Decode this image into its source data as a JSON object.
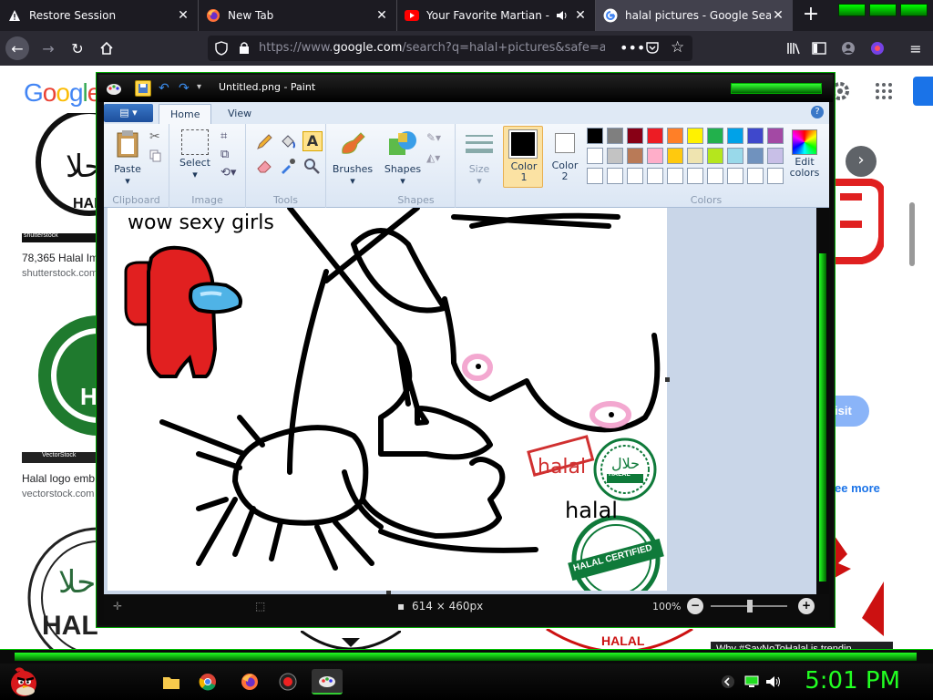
{
  "browser": {
    "tabs": [
      {
        "label": "Restore Session",
        "icon": "warning-icon"
      },
      {
        "label": "New Tab",
        "icon": "firefox-icon"
      },
      {
        "label": "Your Favorite Martian - Sh",
        "icon": "youtube-icon"
      },
      {
        "label": "halal pictures - Google Search",
        "icon": "google-icon"
      }
    ],
    "url_prefix": "https://www.",
    "url_domain": "google.com",
    "url_rest": "/search?q=halal+pictures&safe=a"
  },
  "google": {
    "logo": "Google",
    "results": [
      {
        "caption": "78,365 Halal Im",
        "source": "shutterstock.com",
        "stock": "shutterstock"
      },
      {
        "caption": "Halal logo emb",
        "source": "vectorstock.com",
        "stock": "VectorStock"
      }
    ],
    "visit_label": "isit",
    "see_more": "ee more",
    "trending": "Why #SayNoToHalal is trendin"
  },
  "paint": {
    "title": "Untitled.png - Paint",
    "tabs": [
      "Home",
      "View"
    ],
    "groups": {
      "clipboard": "Clipboard",
      "image": "Image",
      "tools": "Tools",
      "shapes": "Shapes",
      "colors": "Colors"
    },
    "buttons": {
      "paste": "Paste",
      "select": "Select",
      "brushes": "Brushes",
      "shapes": "Shapes",
      "size": "Size",
      "color1": "Color\n1",
      "color2": "Color\n2",
      "edit_colors": "Edit\ncolors"
    },
    "canvas_text": {
      "caption": "wow sexy girls",
      "halal_stamp": "halal",
      "halal_text": "halal",
      "badge_text": "HALAL",
      "certified_text": "HALAL CERTIFIED"
    },
    "status": {
      "dimensions": "614 × 460px",
      "zoom": "100%"
    },
    "palette": [
      "#000000",
      "#7f7f7f",
      "#880015",
      "#ed1c24",
      "#ff7f27",
      "#fff200",
      "#22b14c",
      "#00a2e8",
      "#3f48cc",
      "#a349a4",
      "#ffffff",
      "#c3c3c3",
      "#b97a57",
      "#ffaec9",
      "#ffc90e",
      "#efe4b0",
      "#b5e61d",
      "#99d9ea",
      "#7092be",
      "#c8bfe7"
    ]
  },
  "taskbar": {
    "clock": "5:01 PM"
  }
}
